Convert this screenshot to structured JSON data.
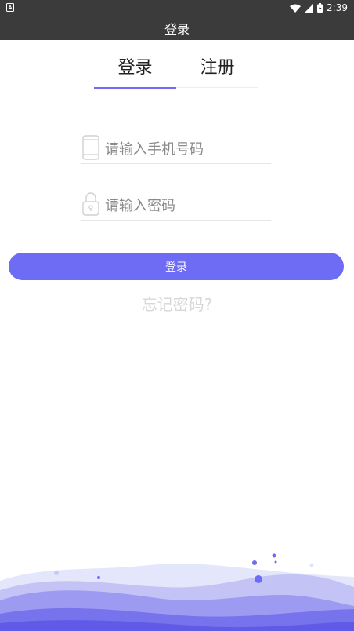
{
  "status_bar": {
    "time": "2:39"
  },
  "header": {
    "title": "登录"
  },
  "tabs": [
    {
      "label": "登录",
      "active": true
    },
    {
      "label": "注册",
      "active": false
    }
  ],
  "form": {
    "phone_placeholder": "请输入手机号码",
    "phone_value": "",
    "password_placeholder": "请输入密码",
    "password_value": "",
    "login_label": "登录",
    "forgot_label": "忘记密码?"
  },
  "colors": {
    "accent": "#6e6bf5",
    "bar_background": "#3b3b3b"
  },
  "icons": [
    "android-notification-icon",
    "wifi-icon",
    "signal-icon",
    "battery-icon",
    "phone-icon",
    "lock-icon"
  ]
}
